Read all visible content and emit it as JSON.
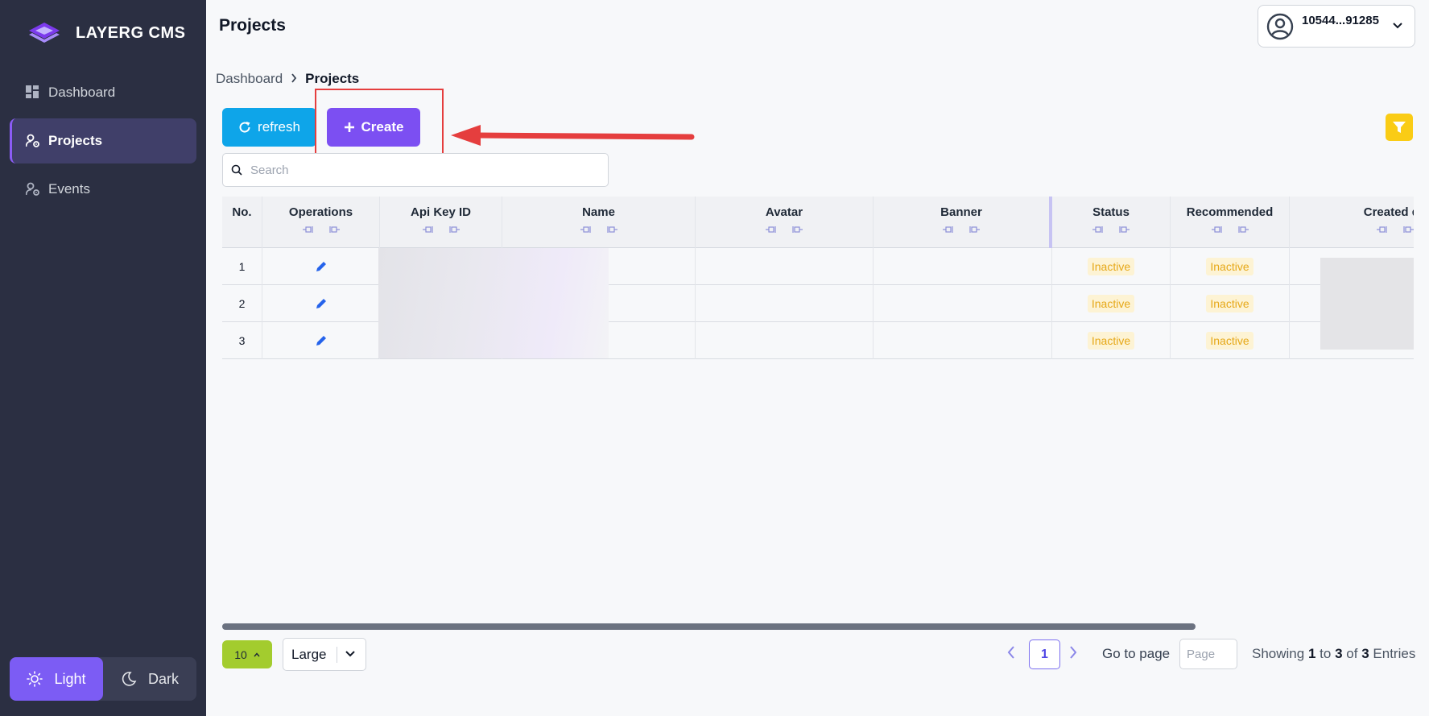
{
  "brand": {
    "name": "LAYERG CMS"
  },
  "sidebar": {
    "items": [
      {
        "label": "Dashboard",
        "icon": "dashboard-icon"
      },
      {
        "label": "Projects",
        "icon": "user-gear-icon",
        "active": true
      },
      {
        "label": "Events",
        "icon": "user-gear-icon"
      }
    ],
    "theme": {
      "light": "Light",
      "dark": "Dark",
      "selected": "Light"
    }
  },
  "header": {
    "title": "Projects",
    "user": "10544...91285"
  },
  "breadcrumb": {
    "home": "Dashboard",
    "current": "Projects"
  },
  "toolbar": {
    "refresh": "refresh",
    "create": "Create"
  },
  "search": {
    "placeholder": "Search",
    "value": ""
  },
  "table": {
    "columns": [
      "No.",
      "Operations",
      "Api Key ID",
      "Name",
      "Avatar",
      "Banner",
      "Status",
      "Recommended",
      "Created da"
    ],
    "rows": [
      {
        "no": "1",
        "status": "Inactive",
        "recommended": "Inactive"
      },
      {
        "no": "2",
        "status": "Inactive",
        "recommended": "Inactive"
      },
      {
        "no": "3",
        "status": "Inactive",
        "recommended": "Inactive"
      }
    ]
  },
  "footer": {
    "page_size": "10",
    "density": "Large",
    "current_page": "1",
    "goto_label": "Go to page",
    "goto_placeholder": "Page",
    "showing_prefix": "Showing",
    "showing_from": "1",
    "showing_to_word": "to",
    "showing_to": "3",
    "showing_of_word": "of",
    "showing_total": "3",
    "showing_suffix": "Entries"
  },
  "colors": {
    "sidebar_bg": "#2b2f42",
    "accent": "#7c4ff2",
    "refresh": "#0ea5e9",
    "filter": "#facc15",
    "page_size": "#a3cc2e",
    "annotation": "#e53e3e"
  }
}
